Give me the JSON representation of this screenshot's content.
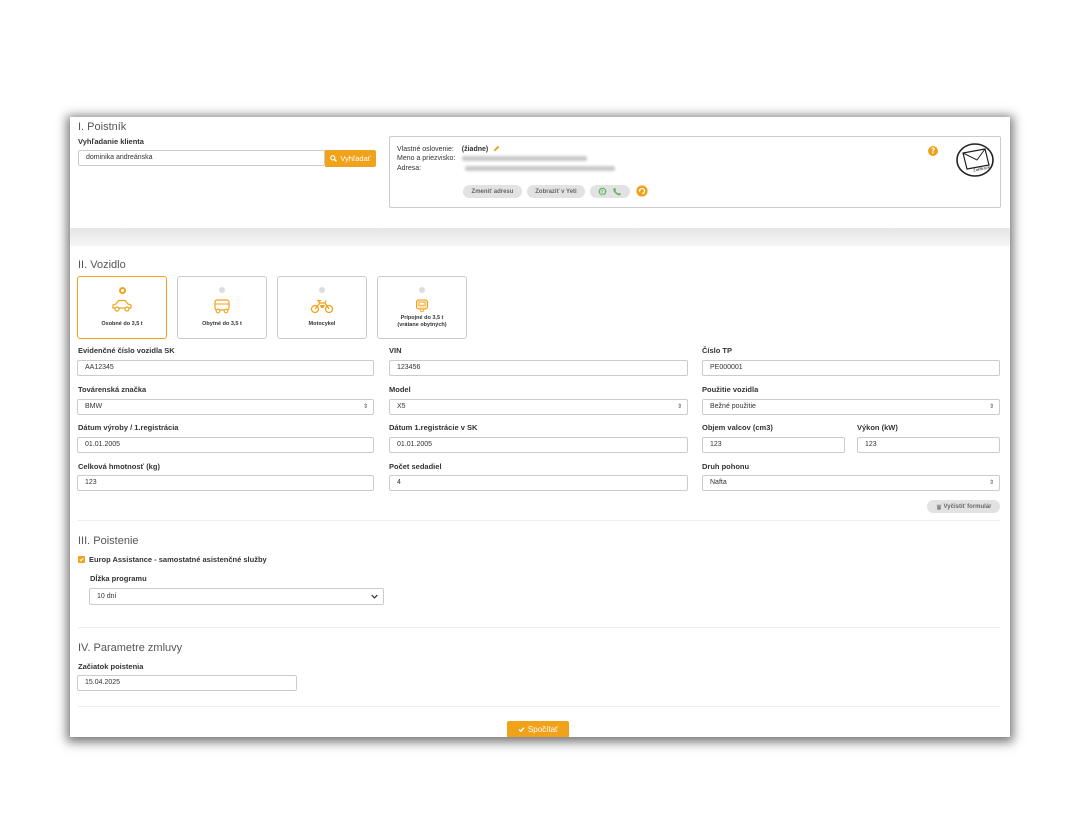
{
  "section1": {
    "title": "I. Poistník",
    "search_label": "Vyhľadanie klienta",
    "search_value": "dominika andreánska",
    "search_button": "Vyhľadať",
    "salutation_label": "Vlastné oslovenie:",
    "salutation_value": "(žiadne)",
    "name_label": "Meno a priezvisko:",
    "address_label": "Adresa:",
    "change_address": "Zmeniť adresu",
    "show_in_yeti": "Zobraziť v Yeti",
    "stamp_text": "Zaklikané"
  },
  "section2": {
    "title": "II. Vozidlo",
    "tiles": [
      {
        "label": "Osobné do 3,5 t",
        "icon": "car-icon"
      },
      {
        "label": "Obytné do 3,5 t",
        "icon": "camper-icon"
      },
      {
        "label": "Motocykel",
        "icon": "motorcycle-icon"
      },
      {
        "label": "Prípojné do 3,5 t",
        "label2": "(vrátane obytných)",
        "icon": "trailer-icon"
      }
    ],
    "fields": {
      "evc_label": "Evidenčné číslo vozidla SK",
      "evc_value": "AA12345",
      "vin_label": "VIN",
      "vin_value": "123456",
      "tp_label": "Číslo TP",
      "tp_value": "PE000001",
      "brand_label": "Továrenská značka",
      "brand_value": "BMW",
      "model_label": "Model",
      "model_value": "X5",
      "usage_label": "Použitie vozidla",
      "usage_value": "Bežné použitie",
      "date_prod_label": "Dátum výroby / 1.registrácia",
      "date_prod_value": "01.01.2005",
      "date_reg_label": "Dátum 1.registrácie v SK",
      "date_reg_value": "01.01.2005",
      "volume_label": "Objem valcov (cm3)",
      "volume_value": "123",
      "power_label": "Výkon (kW)",
      "power_value": "123",
      "weight_label": "Celková hmotnosť (kg)",
      "weight_value": "123",
      "seats_label": "Počet sedadiel",
      "seats_value": "4",
      "drive_label": "Druh pohonu",
      "drive_value": "Nafta"
    },
    "clear_button": "Vyčistiť formulár"
  },
  "section3": {
    "title": "III. Poistenie",
    "checkbox_label": "Europ Assistance - samostatné asistenčné služby",
    "program_label": "Dĺžka programu",
    "program_value": "10 dní"
  },
  "section4": {
    "title": "IV. Parametre zmluvy",
    "start_label": "Začiatok poistenia",
    "start_value": "15.04.2025"
  },
  "submit_button": "Spočítať",
  "colors": {
    "accent": "#f0a21a",
    "border": "#cccccc",
    "green": "#6bb26b"
  }
}
